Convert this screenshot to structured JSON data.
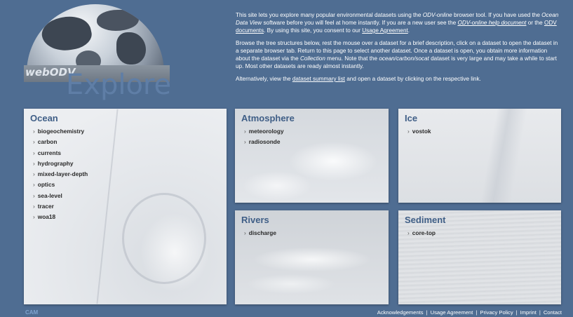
{
  "logo": {
    "web_text": "webODV",
    "explore_text": "Explore"
  },
  "intro": {
    "p1": [
      {
        "t": "This site lets you explore many popular environmental datasets using the ",
        "s": ""
      },
      {
        "t": "ODV-online",
        "s": "i"
      },
      {
        "t": " browser tool. If you have used the ",
        "s": ""
      },
      {
        "t": "Ocean Data View",
        "s": "i"
      },
      {
        "t": " software before you will feel at home instantly. If you are a new user see the ",
        "s": ""
      },
      {
        "t": "ODV-online help document",
        "s": "ui"
      },
      {
        "t": " or the ",
        "s": ""
      },
      {
        "t": "ODV documents",
        "s": "u"
      },
      {
        "t": ". By using this site, you consent to our ",
        "s": ""
      },
      {
        "t": "Usage Agreement",
        "s": "u"
      },
      {
        "t": ".",
        "s": ""
      }
    ],
    "p2": [
      {
        "t": "Browse the tree structures below, rest the mouse over a dataset for a brief description, click on a dataset to open the dataset in a separate browser tab. Return to this page to select another dataset. Once a dataset is open, you obtain more information about the dataset via the ",
        "s": ""
      },
      {
        "t": "Collection",
        "s": "i"
      },
      {
        "t": " menu. Note that the ",
        "s": ""
      },
      {
        "t": "ocean/carbon/socat",
        "s": "i"
      },
      {
        "t": " dataset is very large and may take a while to start up. Most other datasets are ready almost instantly.",
        "s": ""
      }
    ],
    "p3": [
      {
        "t": "Alternatively, view the ",
        "s": ""
      },
      {
        "t": "dataset summary list",
        "s": "u"
      },
      {
        "t": " and open a dataset by clicking on the respective link.",
        "s": ""
      }
    ]
  },
  "panels": {
    "ocean": {
      "title": "Ocean",
      "items": [
        "biogeochemistry",
        "carbon",
        "currents",
        "hydrography",
        "mixed-layer-depth",
        "optics",
        "sea-level",
        "tracer",
        "woa18"
      ]
    },
    "atmosphere": {
      "title": "Atmosphere",
      "items": [
        "meteorology",
        "radiosonde"
      ]
    },
    "ice": {
      "title": "Ice",
      "items": [
        "vostok"
      ]
    },
    "rivers": {
      "title": "Rivers",
      "items": [
        "discharge"
      ]
    },
    "sediment": {
      "title": "Sediment",
      "items": [
        "core-top"
      ]
    }
  },
  "chevron": "›",
  "footer": {
    "logo_text": "CAM",
    "links": [
      "Acknowledgements",
      "Usage Agreement",
      "Privacy Policy",
      "Imprint",
      "Contact"
    ],
    "separator": "|"
  }
}
